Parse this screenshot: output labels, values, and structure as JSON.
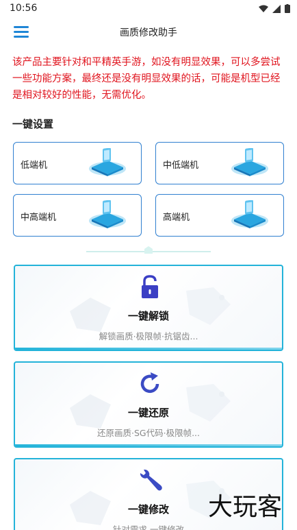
{
  "status": {
    "time": "10:56"
  },
  "header": {
    "title": "画质修改助手"
  },
  "notice": "该产品主要针对和平精英手游，如没有明显效果，可以多尝试一些功能方案，最终还是没有明显效果的话，可能是机型已经是相对较好的性能，无需优化。",
  "presets": {
    "title": "一键设置",
    "items": [
      {
        "label": "低端机"
      },
      {
        "label": "中低端机"
      },
      {
        "label": "中高端机"
      },
      {
        "label": "高端机"
      }
    ]
  },
  "cards": [
    {
      "title": "一键解锁",
      "subtitle": "解锁画质·极限帧·抗锯齿...",
      "icon": "unlock-icon",
      "color": "#3b3fc4"
    },
    {
      "title": "一键还原",
      "subtitle": "还原画质·SG代码·极限帧...",
      "icon": "refresh-icon",
      "color": "#3b4bc4"
    },
    {
      "title": "一键修改",
      "subtitle": "针对需求 一键修改",
      "icon": "wrench-icon",
      "color": "#3b4bc4"
    }
  ],
  "watermark": "大玩客",
  "colors": {
    "accent": "#1f86d6",
    "notice": "#e0141e",
    "card_border": "#23b3d9"
  }
}
